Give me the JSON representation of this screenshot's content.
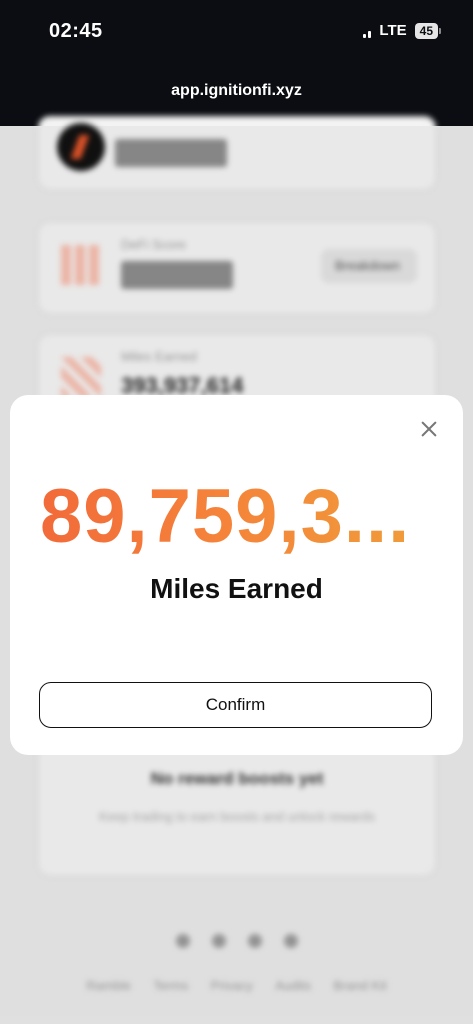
{
  "status_bar": {
    "time": "02:45",
    "network": "LTE",
    "battery": "45"
  },
  "browser": {
    "url": "app.ignitionfi.xyz"
  },
  "background": {
    "defi_score_label": "DeFi Score",
    "breakdown_button": "Breakdown",
    "miles_earned_label": "Miles Earned",
    "miles_earned_value": "393,937,614",
    "no_boosts_title": "No reward boosts yet",
    "no_boosts_text": "Keep trading to earn boosts and unlock rewards",
    "footer_links": [
      "Ramble",
      "Terms",
      "Privacy",
      "Audits",
      "Brand Kit"
    ]
  },
  "modal": {
    "value": "89,759,3...",
    "label": "Miles Earned",
    "confirm_label": "Confirm"
  },
  "colors": {
    "accent_start": "#f26a3a",
    "accent_end": "#f09b3a",
    "topbar": "#0b0d12"
  }
}
